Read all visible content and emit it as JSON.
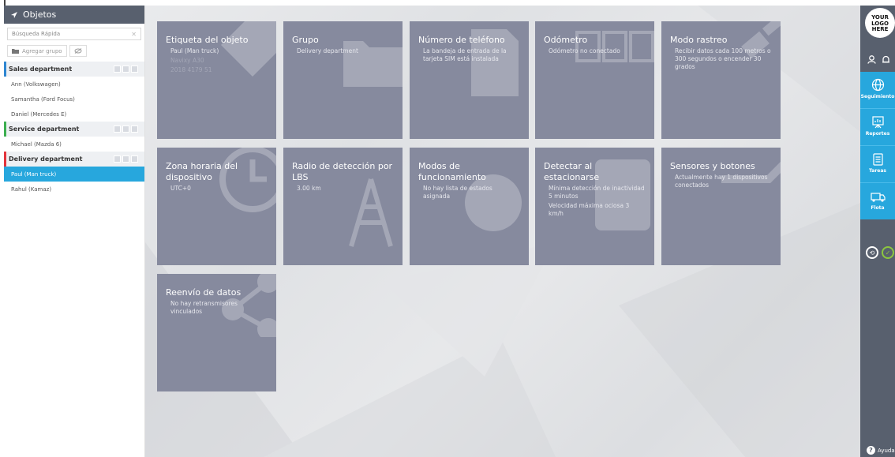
{
  "left_panel": {
    "title": "Objetos",
    "search_placeholder": "Búsqueda Rápida",
    "add_group_label": "Agregar grupo",
    "groups": [
      {
        "name": "Sales department",
        "color": "#2e86d1",
        "items": [
          "Ann (Volkswagen)",
          "Samantha (Ford Focus)",
          "Daniel (Mercedes E)"
        ]
      },
      {
        "name": "Service department",
        "color": "#3cae4f",
        "items": [
          "Michael (Mazda 6)"
        ]
      },
      {
        "name": "Delivery department",
        "color": "#e3343c",
        "items": [
          "Paul (Man truck)",
          "Rahul (Kamaz)"
        ]
      }
    ],
    "selected_item": "Paul (Man truck)"
  },
  "tiles": [
    {
      "title": "Etiqueta del objeto",
      "lines": [
        "Paul (Man truck)",
        "Navixy A30",
        "2018 4179 51"
      ]
    },
    {
      "title": "Grupo",
      "lines": [
        "Delivery department"
      ]
    },
    {
      "title": "Número de teléfono",
      "lines": [
        "La bandeja de entrada de la tarjeta SIM está instalada"
      ]
    },
    {
      "title": "Odómetro",
      "lines": [
        "Odómetro no conectado"
      ]
    },
    {
      "title": "Modo rastreo",
      "lines": [
        "Recibir datos cada 100 metros o 300 segundos o encender 30 grados"
      ]
    },
    {
      "title": "Zona horaria del dispositivo",
      "lines": [
        "UTC+0"
      ]
    },
    {
      "title": "Radio de detección por LBS",
      "lines": [
        "3.00 km"
      ]
    },
    {
      "title": "Modos de funcionamiento",
      "lines": [
        "No hay lista de estados asignada"
      ]
    },
    {
      "title": "Detectar al estacionarse",
      "lines": [
        "Mínima detección de inactividad 5 minutos",
        "Velocidad máxima ociosa 3 km/h"
      ]
    },
    {
      "title": "Sensores y botones",
      "lines": [
        "Actualmente hay 1 dispositivos conectados"
      ]
    },
    {
      "title": "Reenvío de datos",
      "lines": [
        "No hay retransmisores vinculados"
      ]
    }
  ],
  "right_bar": {
    "logo_text": "YOUR LOGO HERE",
    "nav": [
      {
        "label": "Seguimiento",
        "icon": "globe-icon"
      },
      {
        "label": "Reportes",
        "icon": "presentation-icon"
      },
      {
        "label": "Tareas",
        "icon": "clipboard-icon"
      },
      {
        "label": "Flota",
        "icon": "truck-icon"
      }
    ],
    "help_label": "Ayuda"
  },
  "colors": {
    "sidebar": "#58606e",
    "accent": "#27a7dd",
    "tile": "#868a9e"
  }
}
